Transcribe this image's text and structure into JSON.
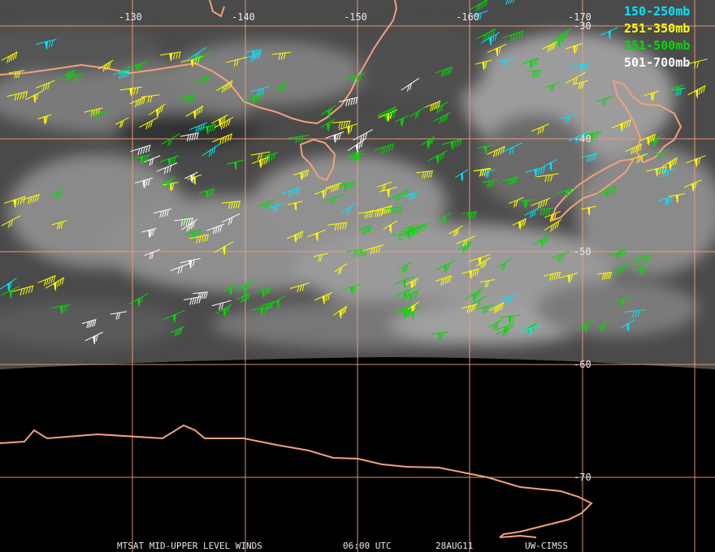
{
  "map": {
    "longitude_labels": [
      "-130",
      "-140",
      "-150",
      "-160",
      "-170"
    ],
    "latitude_labels": [
      "-30",
      "-40",
      "-50",
      "-60",
      "-70"
    ],
    "grid_color": "#f4a07a",
    "coast_color": "#f4a07a"
  },
  "legend": [
    {
      "label": "150-250mb",
      "color": "#00e5ff"
    },
    {
      "label": "251-350mb",
      "color": "#ffff00"
    },
    {
      "label": "351-500mb",
      "color": "#00dd00"
    },
    {
      "label": "501-700mb",
      "color": "#ffffff"
    }
  ],
  "footer": {
    "product": "MTSAT MID-UPPER LEVEL WINDS",
    "time": "06:00 UTC",
    "date": "28AUG11",
    "source": "UW-CIMSS"
  }
}
